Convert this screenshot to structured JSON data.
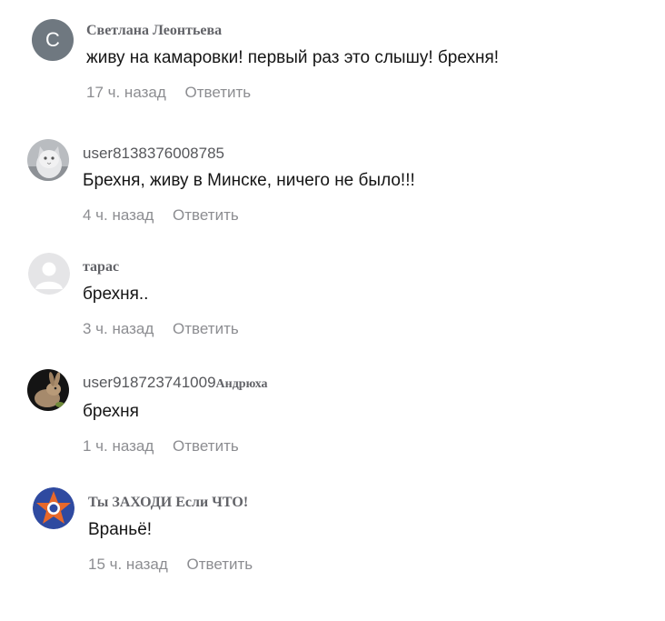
{
  "comments": [
    {
      "author": "Светлана Леонтьева",
      "avatar_letter": "С",
      "avatar_color": "#6f7880",
      "text": "живу на камаровки! первый раз это слышу! брехня!",
      "time": "17 ч. назад",
      "reply_label": "Ответить"
    },
    {
      "author": "user8138376008785",
      "avatar_icon": "cat-photo-icon",
      "text": "Брехня, живу в Минске, ничего не было!!!",
      "time": "4 ч. назад",
      "reply_label": "Ответить"
    },
    {
      "author": "тарас",
      "avatar_icon": "default-user-icon",
      "text": "брехня..",
      "time": "3 ч. назад",
      "reply_label": "Ответить"
    },
    {
      "author_prefix": "user918723741009",
      "author_suffix": "Андрюха",
      "avatar_icon": "rabbit-photo-icon",
      "text": "брехня",
      "time": "1 ч. назад",
      "reply_label": "Ответить"
    },
    {
      "author": "Ты ЗАХОДИ Если ЧТО!",
      "avatar_icon": "star-emblem-icon",
      "text": "Враньё!",
      "time": "15 ч. назад",
      "reply_label": "Ответить"
    }
  ]
}
